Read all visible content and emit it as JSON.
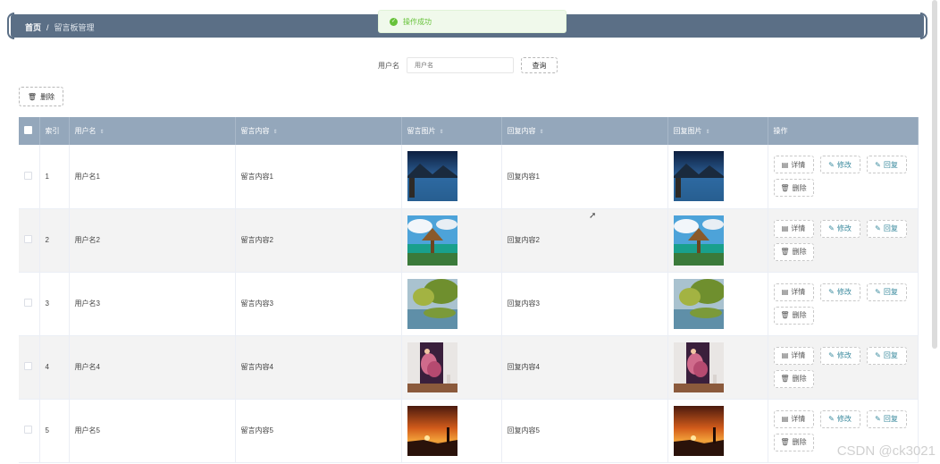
{
  "breadcrumb": {
    "home": "首页",
    "separator": "/",
    "current": "留言板管理"
  },
  "toast": {
    "message": "操作成功",
    "icon": "check-circle-icon"
  },
  "search": {
    "label": "用户名",
    "placeholder": "用户名",
    "button": "查询"
  },
  "toolbar": {
    "delete_label": "删除",
    "delete_icon": "trash-icon"
  },
  "table": {
    "headers": {
      "index": "索引",
      "username": "用户名",
      "content": "留言内容",
      "image": "留言图片",
      "reply": "回复内容",
      "reply_image": "回复图片",
      "ops": "操作"
    },
    "rows": [
      {
        "index": "1",
        "username": "用户名1",
        "content": "留言内容1",
        "reply": "回复内容1"
      },
      {
        "index": "2",
        "username": "用户名2",
        "content": "留言内容2",
        "reply": "回复内容2"
      },
      {
        "index": "3",
        "username": "用户名3",
        "content": "留言内容3",
        "reply": "回复内容3"
      },
      {
        "index": "4",
        "username": "用户名4",
        "content": "留言内容4",
        "reply": "回复内容4"
      },
      {
        "index": "5",
        "username": "用户名5",
        "content": "留言内容5",
        "reply": "回复内容5"
      }
    ],
    "actions": {
      "detail": "详情",
      "edit": "修改",
      "reply": "回复",
      "delete": "删除"
    }
  },
  "watermark": "CSDN @ck3021",
  "colors": {
    "header": "#5b6f86",
    "table_header": "#94a7bb",
    "success": "#67c23a",
    "accent": "#3a8a9e"
  }
}
